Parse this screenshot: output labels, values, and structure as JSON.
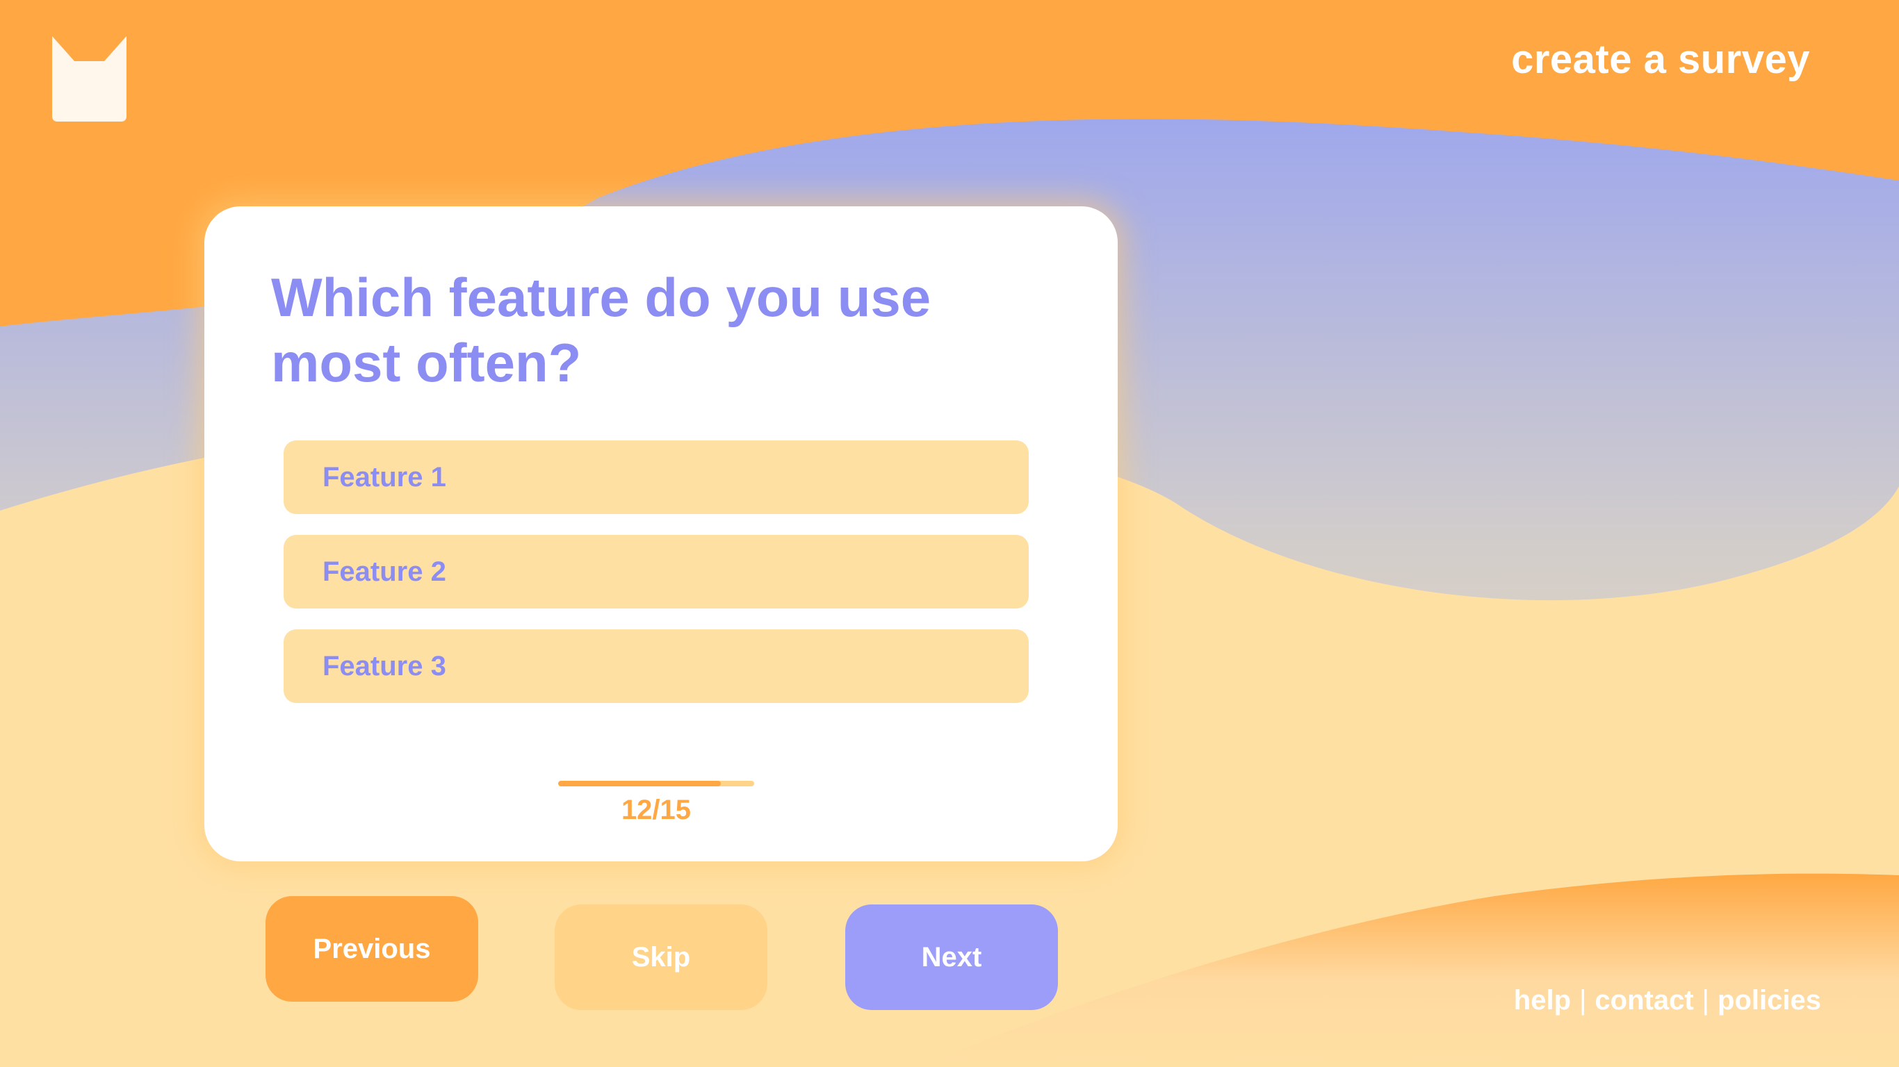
{
  "header": {
    "nav_link": "create a survey"
  },
  "survey": {
    "question": "Which feature do you use most often?",
    "options": [
      {
        "label": "Feature 1"
      },
      {
        "label": "Feature 2"
      },
      {
        "label": "Feature 3"
      }
    ],
    "progress": {
      "text": "12/15",
      "current": 12,
      "total": 15,
      "fill_fraction": 0.83
    }
  },
  "actions": {
    "previous_label": "Previous",
    "skip_label": "Skip",
    "next_label": "Next"
  },
  "footer": {
    "links": [
      "help",
      "contact",
      "policies"
    ],
    "separator": "|"
  },
  "icons": {
    "logo": "cat-head-logo-icon"
  },
  "colors": {
    "orange": "#FFA843",
    "light_orange": "#FFD489",
    "cream": "#FFE0A3",
    "periwinkle": "#8C8DF3",
    "button_purple": "#9C9DF8",
    "white": "#FFFFFF"
  }
}
